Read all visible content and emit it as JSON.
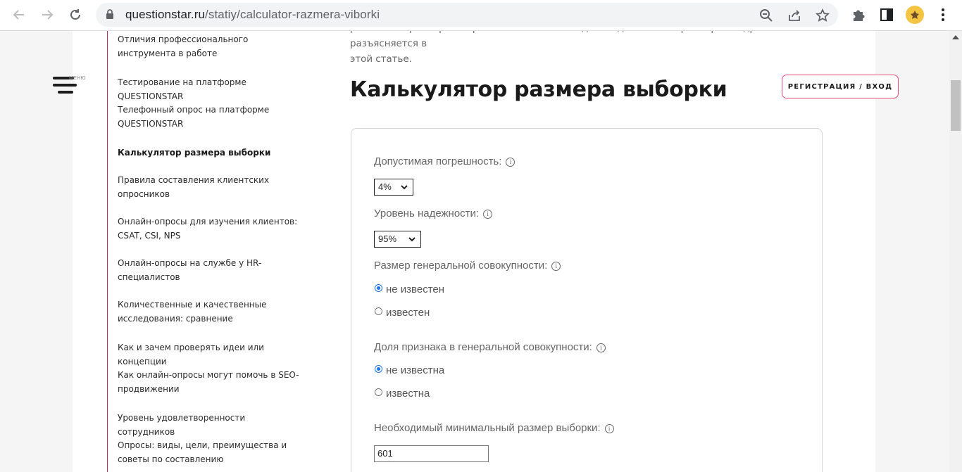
{
  "browser": {
    "url_host": "questionstar.ru",
    "url_path": "/statiy/calculator-razmera-viborki",
    "icons": [
      "back-arrow-icon",
      "forward-arrow-icon",
      "reload-icon",
      "lock-icon",
      "zoom-icon",
      "share-icon",
      "star-icon",
      "puzzle-icon",
      "side-panel-icon",
      "avatar",
      "kebab-menu-icon"
    ]
  },
  "header": {
    "menu_label": "МЕНЮ",
    "login_label": "РЕГИСТРАЦИЯ / ВХОД",
    "accent_color": "#e84a7a"
  },
  "sidebar": {
    "items": [
      {
        "label": "Отличия профессионального инструмента в работе"
      },
      {
        "label": "Тестирование на платформе QUESTIONSTAR"
      },
      {
        "label": "Телефонный опрос на платформе QUESTIONSTAR"
      },
      {
        "label": "Калькулятор размера выборки",
        "active": true
      },
      {
        "label": "Правила составления клиентских опросников"
      },
      {
        "label": "Онлайн-опросы для изучения клиентов: CSAT, CSI, NPS"
      },
      {
        "label": "Онлайн-опросы на службе у HR-специалистов"
      },
      {
        "label": "Количественные и качественные исследования: сравнение"
      },
      {
        "label": "Как и зачем проверять идеи или концепции"
      },
      {
        "label": "Как онлайн-опросы могут помочь в SEO-продвижении"
      },
      {
        "label": "Уровень удовлетворенности сотрудников"
      },
      {
        "label": "Опросы: виды, цели, преимущества и советы по составлению"
      }
    ]
  },
  "article": {
    "intro_line1": "рассчитать размер выборки. Значение необходимых для этого параметров подробно разъясняется в",
    "intro_line2": "этой статье.",
    "title": "Калькулятор размера выборки"
  },
  "calculator": {
    "error_label": "Допустимая погрешность:",
    "error_value": "4%",
    "confidence_label": "Уровень надежности:",
    "confidence_value": "95%",
    "population_label": "Размер генеральной совокупности:",
    "population_options": [
      "не известен",
      "известен"
    ],
    "population_selected": 0,
    "proportion_label": "Доля признака в генеральной совокупности:",
    "proportion_options": [
      "не известна",
      "известна"
    ],
    "proportion_selected": 0,
    "result_label": "Необходимый минимальный размер выборки:",
    "result_value": "601",
    "info_glyph": "i"
  }
}
